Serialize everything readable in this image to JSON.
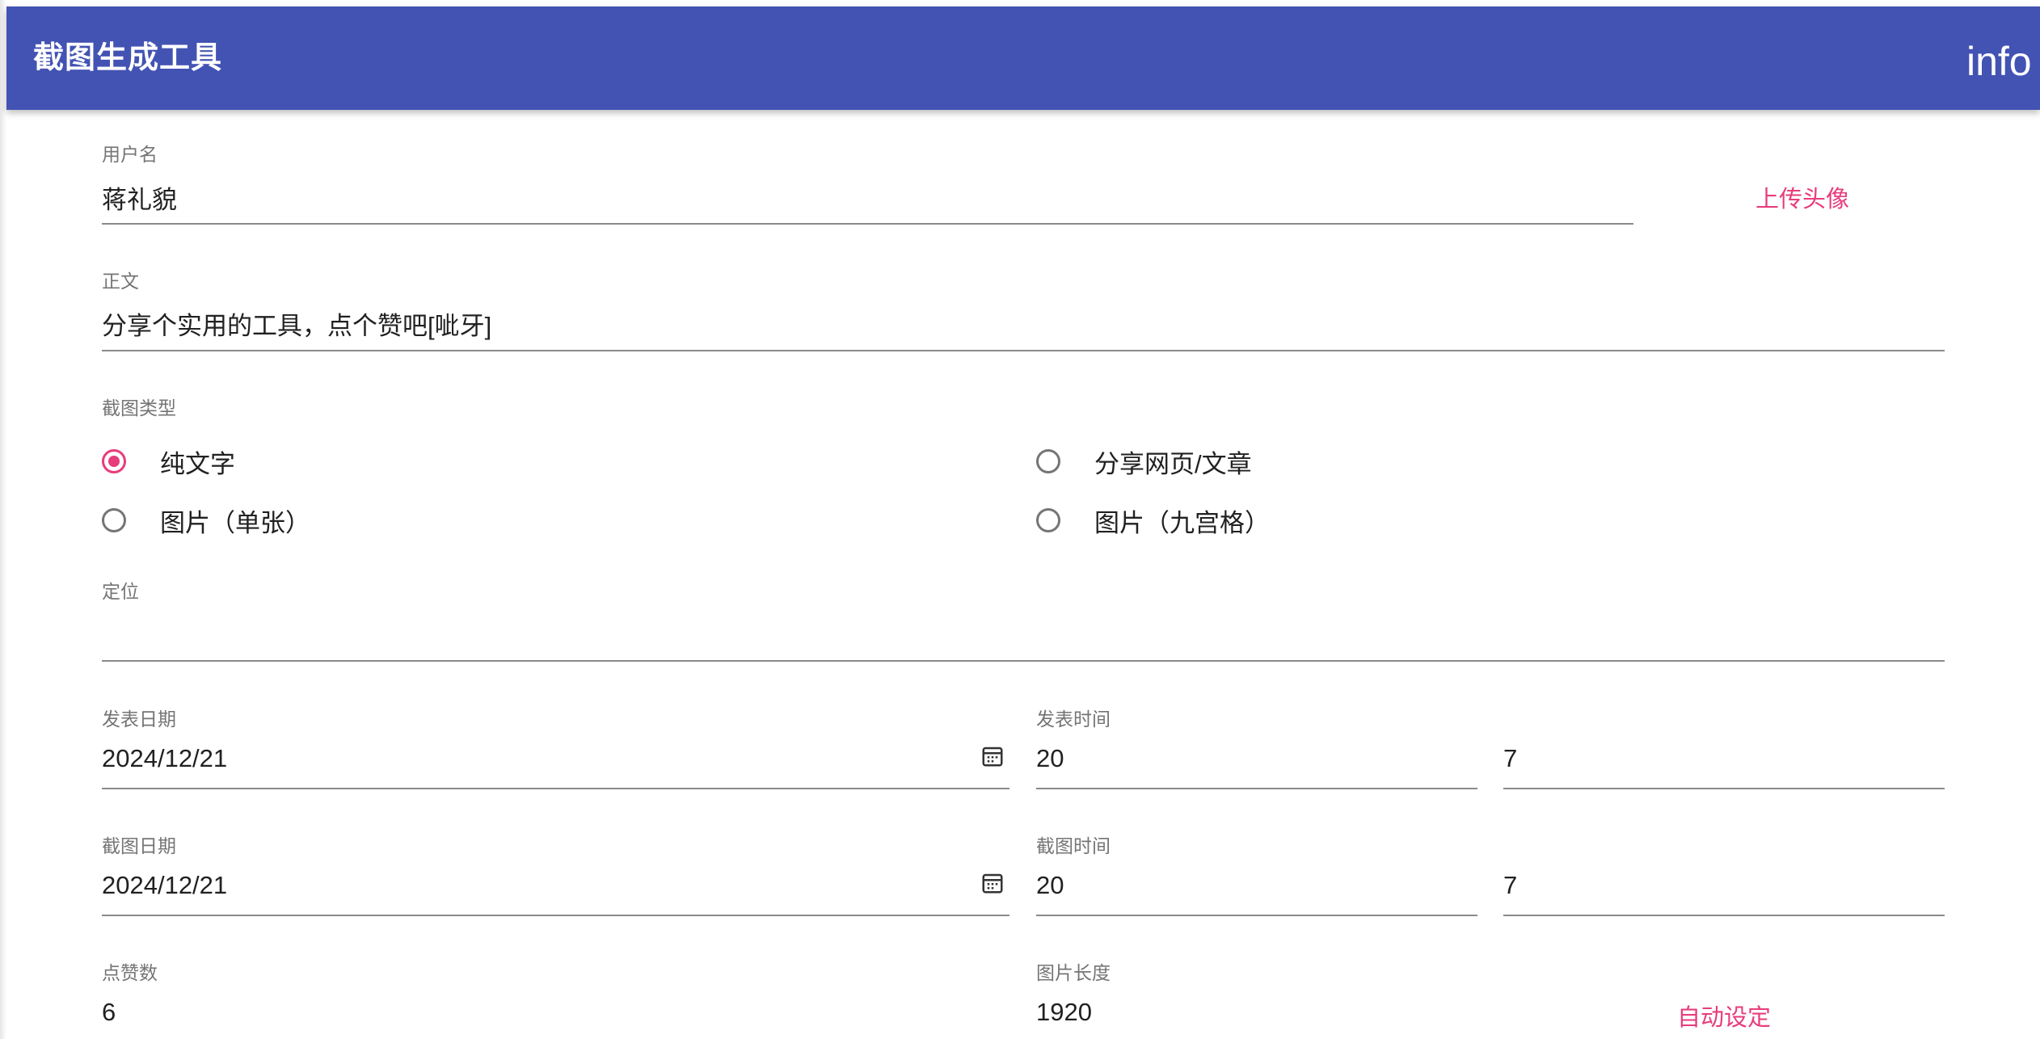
{
  "header": {
    "title": "截图生成工具",
    "right_text": "info"
  },
  "username": {
    "label": "用户名",
    "value": "蒋礼貌",
    "upload_label": "上传头像"
  },
  "body_text": {
    "label": "正文",
    "value": "分享个实用的工具，点个赞吧[呲牙]"
  },
  "screenshot_type": {
    "label": "截图类型",
    "options": [
      {
        "label": "纯文字",
        "checked": true
      },
      {
        "label": "分享网页/文章",
        "checked": false
      },
      {
        "label": "图片（单张）",
        "checked": false
      },
      {
        "label": "图片（九宫格）",
        "checked": false
      }
    ]
  },
  "location": {
    "label": "定位",
    "value": ""
  },
  "publish": {
    "date_label": "发表日期",
    "date_value": "2024/12/21",
    "time_label": "发表时间",
    "hour": "20",
    "minute": "7"
  },
  "capture": {
    "date_label": "截图日期",
    "date_value": "2024/12/21",
    "time_label": "截图时间",
    "hour": "20",
    "minute": "7"
  },
  "likes": {
    "label": "点赞数",
    "value": "6"
  },
  "image_length": {
    "label": "图片长度",
    "value": "1920",
    "auto_label": "自动设定"
  },
  "colors": {
    "appbar": "#4353b3",
    "accent": "#e73c7c",
    "label": "#757575",
    "text": "#212121"
  },
  "icons": [
    "calendar-icon",
    "radio-checked-icon",
    "radio-unchecked-icon"
  ]
}
